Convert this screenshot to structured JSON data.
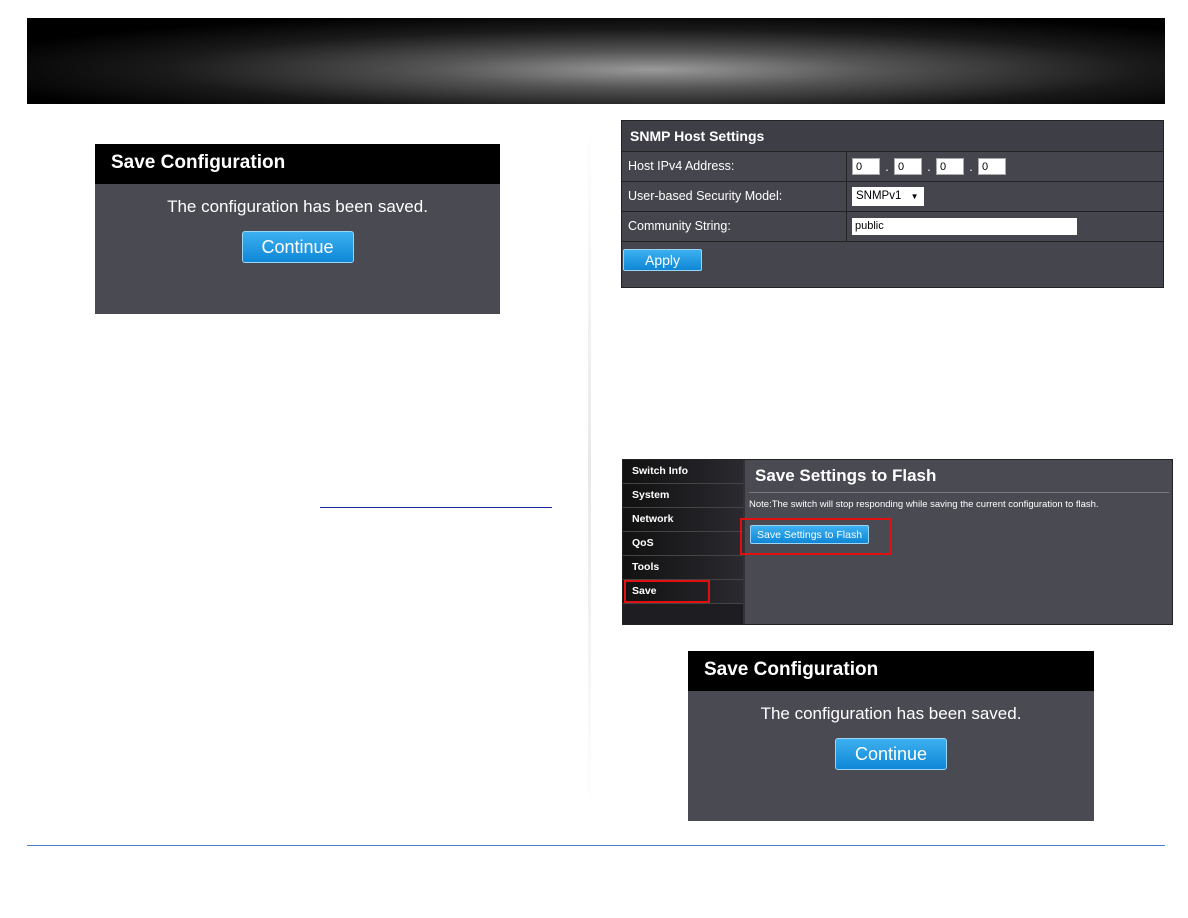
{
  "dialog_save_config": {
    "title": "Save Configuration",
    "message": "The configuration has been saved.",
    "continue_label": "Continue"
  },
  "snmp": {
    "title": "SNMP Host Settings",
    "host_ipv4_label": "Host IPv4 Address:",
    "ip_octets": [
      "0",
      "0",
      "0",
      "0"
    ],
    "security_model_label": "User-based Security Model:",
    "security_model_value": "SNMPv1",
    "community_label": "Community String:",
    "community_value": "public",
    "apply_label": "Apply"
  },
  "flash": {
    "sidebar": [
      {
        "label": "Switch Info"
      },
      {
        "label": "System"
      },
      {
        "label": "Network"
      },
      {
        "label": "QoS"
      },
      {
        "label": "Tools"
      },
      {
        "label": "Save"
      }
    ],
    "title": "Save Settings to Flash",
    "note": "Note:The switch will stop responding while saving the current configuration to flash.",
    "button_label": "Save Settings to Flash"
  },
  "colors": {
    "accent_button": "#1a9ae6",
    "highlight": "#e01010",
    "footer_rule": "#4a7fd4"
  }
}
